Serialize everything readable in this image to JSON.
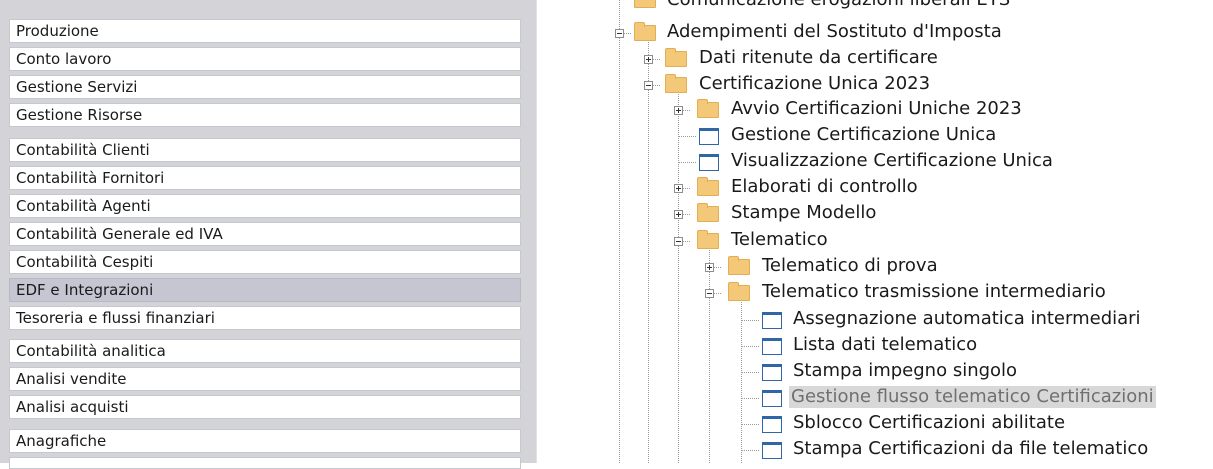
{
  "menu": {
    "group1": [
      "Produzione",
      "Conto lavoro",
      "Gestione Servizi",
      "Gestione Risorse"
    ],
    "group2": [
      "Contabilità Clienti",
      "Contabilità Fornitori",
      "Contabilità Agenti",
      "Contabilità Generale ed IVA",
      "Contabilità Cespiti",
      "EDF e Integrazioni",
      "Tesoreria e flussi finanziari"
    ],
    "selected": "EDF e Integrazioni",
    "group3": [
      "Contabilità analitica",
      "Analisi vendite",
      "Analisi acquisti"
    ],
    "group4": [
      "Anagrafiche"
    ]
  },
  "tree": {
    "partial_top": "Comunicazione erogazioni liberali ETS",
    "adempimenti": "Adempimenti del Sostituto d'Imposta",
    "dati_ritenute": "Dati ritenute da certificare",
    "cu_2023": "Certificazione Unica 2023",
    "avvio_cu": "Avvio Certificazioni Uniche 2023",
    "gestione_cu": "Gestione Certificazione Unica",
    "visualizzazione_cu": "Visualizzazione Certificazione Unica",
    "elaborati": "Elaborati di controllo",
    "stampe_modello": "Stampe Modello",
    "telematico": "Telematico",
    "telematico_prova": "Telematico di prova",
    "telematico_intermediario": "Telematico trasmissione intermediario",
    "assegnazione": "Assegnazione automatica intermediari",
    "lista_dati": "Lista dati telematico",
    "stampa_impegno": "Stampa impegno singolo",
    "gestione_flusso": "Gestione flusso telematico Certificazioni",
    "sblocco": "Sblocco Certificazioni abilitate",
    "stampa_cert_file": "Stampa Certificazioni da file telematico"
  },
  "colors": {
    "folder": "#f4c879",
    "window_icon": "#2e66a8",
    "selected_menu": "#c5c6d2",
    "tree_highlight": "#d8d8d8"
  }
}
